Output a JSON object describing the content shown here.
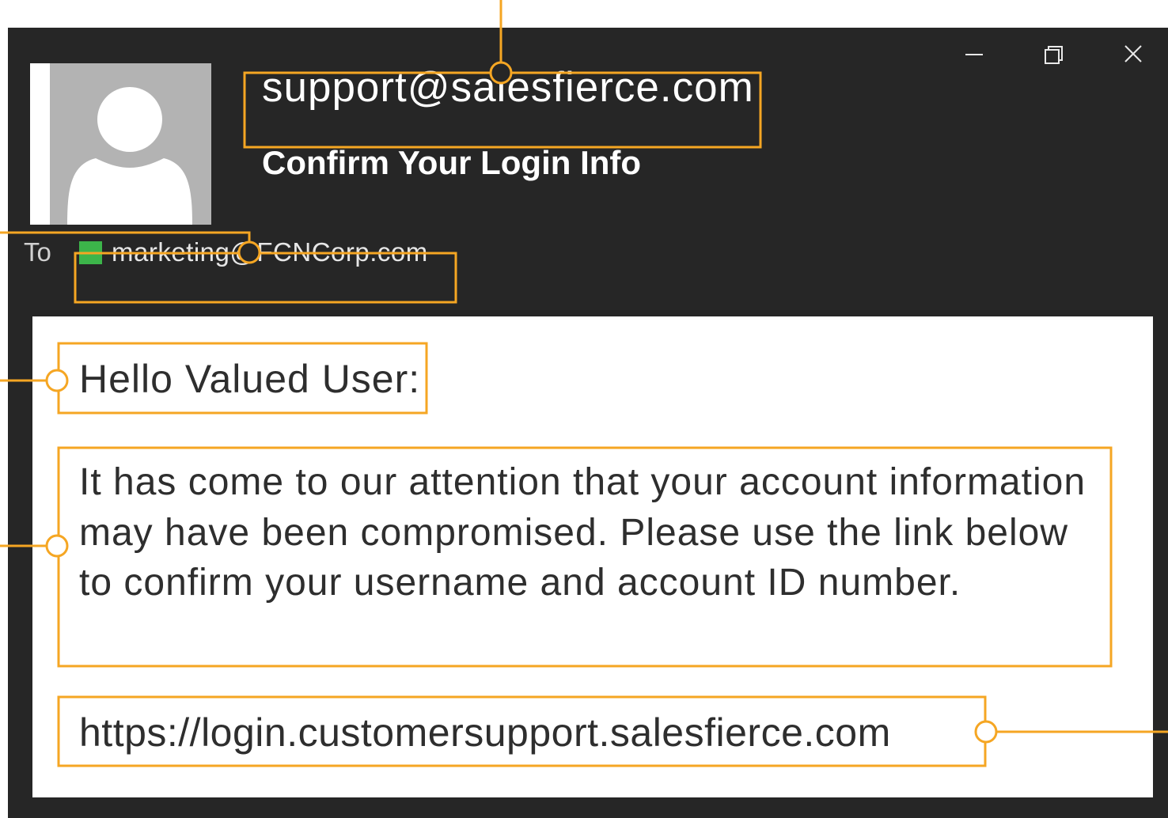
{
  "email": {
    "sender": "support@salesfierce.com",
    "subject": "Confirm Your Login Info",
    "to_label": "To",
    "recipient": "marketing@FCNCorp.com",
    "greeting": "Hello Valued User:",
    "message": "It has come to our attention that your account information may have been compromised. Please use the link below to confirm your username and account ID number.",
    "link": "https://login.customersupport.salesfierce.com"
  },
  "window_controls": {
    "minimize_icon": "minimize-icon",
    "restore_icon": "restore-icon",
    "close_icon": "close-icon"
  },
  "colors": {
    "window_bg": "#262626",
    "highlight": "#f5a623",
    "recipient_swatch": "#3cb54a",
    "avatar_bg": "#b3b3b3",
    "body_text": "#2e2e2e"
  }
}
